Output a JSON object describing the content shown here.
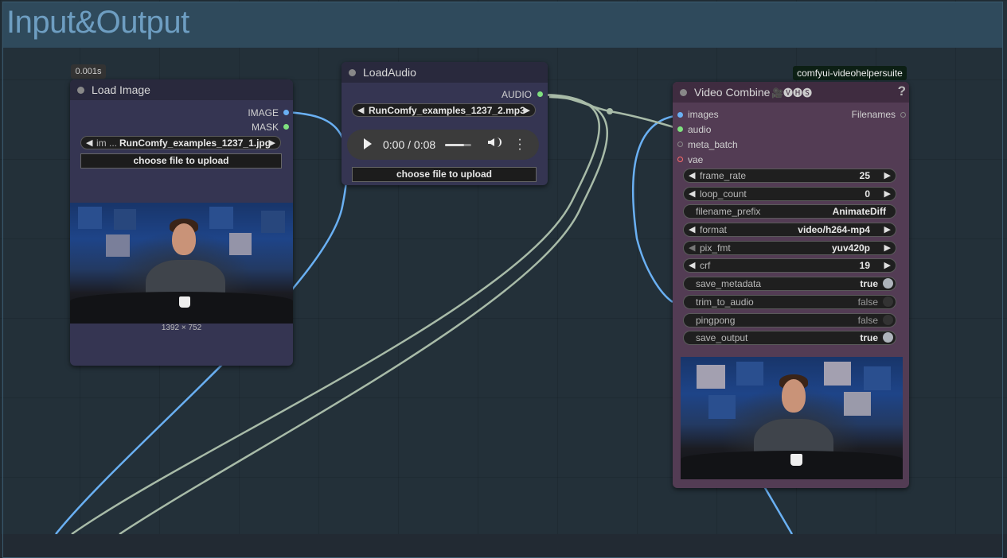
{
  "group": {
    "title": "Input&Output"
  },
  "timing_badge": "0.001s",
  "load_image": {
    "title": "Load Image",
    "outputs": [
      "IMAGE",
      "MASK"
    ],
    "combo_name": "im ...",
    "combo_value": "RunComfy_examples_1237_1.jpg",
    "upload_button": "choose file to upload",
    "image_size": "1392 × 752"
  },
  "load_audio": {
    "title": "LoadAudio",
    "output": "AUDIO",
    "combo_value": "RunComfy_examples_1237_2.mp3",
    "player_time": "0:00 / 0:08",
    "upload_button": "choose file to upload"
  },
  "video_combine": {
    "badge": "comfyui-videohelpersuite",
    "title": "Video Combine",
    "title_icons": "🎥🅥🅗🅢",
    "help": "?",
    "inputs": [
      {
        "label": "images",
        "color": "#6ab0f3"
      },
      {
        "label": "audio",
        "color": "#7fe07f"
      },
      {
        "label": "meta_batch",
        "color": "#666666"
      },
      {
        "label": "vae",
        "color": "#ff6b6b"
      }
    ],
    "output": "Filenames",
    "widgets": [
      {
        "name": "frame_rate",
        "value": "25"
      },
      {
        "name": "loop_count",
        "value": "0"
      },
      {
        "name": "filename_prefix",
        "value": "AnimateDiff"
      },
      {
        "name": "format",
        "value": "video/h264-mp4"
      },
      {
        "name": "pix_fmt",
        "value": "yuv420p"
      },
      {
        "name": "crf",
        "value": "19"
      },
      {
        "name": "save_metadata",
        "value": "true"
      },
      {
        "name": "trim_to_audio",
        "value": "false"
      },
      {
        "name": "pingpong",
        "value": "false"
      },
      {
        "name": "save_output",
        "value": "true"
      }
    ]
  },
  "colors": {
    "node_bg_blue": "#353552",
    "node_header_blue": "#29293d",
    "node_bg_purple": "#533c54",
    "node_header_purple": "#3f2c40",
    "wire_image": "#6ab0f3",
    "wire_audio": "#a8bba8"
  }
}
